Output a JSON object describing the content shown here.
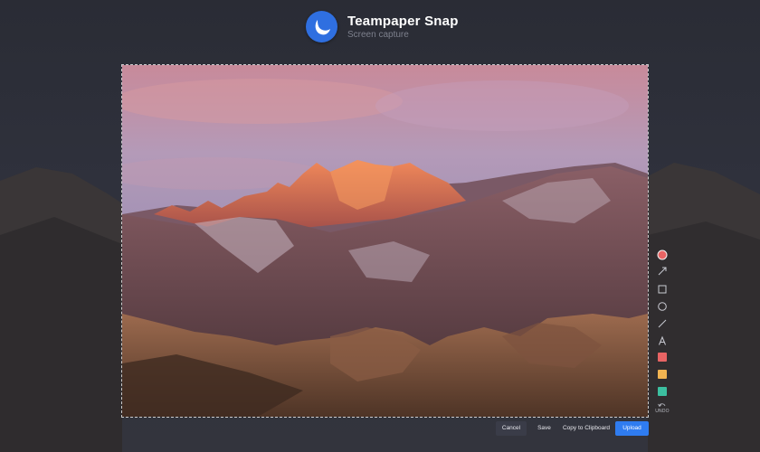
{
  "app": {
    "title": "Teampaper Snap",
    "subtitle": "Screen capture"
  },
  "toolbar": {
    "tools": [
      "record-dot",
      "arrow",
      "rectangle",
      "ellipse",
      "line",
      "text"
    ],
    "colors": [
      "#e86464",
      "#f2b451",
      "#3cbfa0"
    ],
    "undo_label": "UNDO"
  },
  "actions": {
    "cancel": "Cancel",
    "save": "Save",
    "copy": "Copy to Clipboard",
    "upload": "Upload"
  },
  "colors": {
    "accent": "#2f7cf0",
    "logo": "#2f6fe0"
  }
}
